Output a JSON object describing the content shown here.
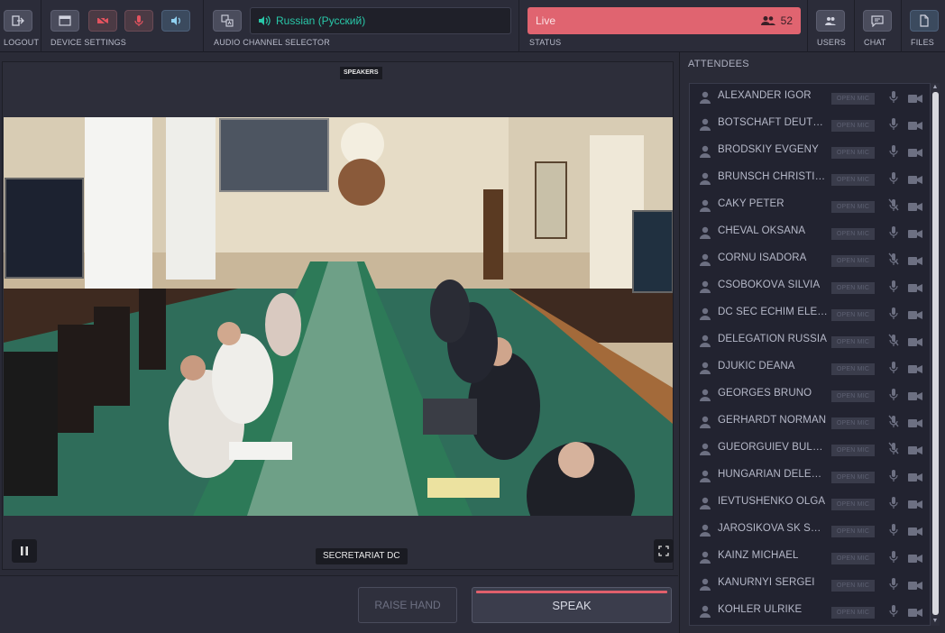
{
  "toolbar": {
    "logout_label": "LOGOUT",
    "device_settings_label": "DEVICE SETTINGS",
    "audio_channel_label": "AUDIO CHANNEL SELECTOR",
    "audio_language": "Russian (Русский)",
    "status_label": "STATUS",
    "status_text": "Live",
    "participant_count": "52",
    "users_label": "USERS",
    "chat_label": "CHAT",
    "files_label": "FILES"
  },
  "video": {
    "speakers_tag": "SPEAKERS",
    "source_label": "SECRETARIAT DC"
  },
  "actions": {
    "raise_hand": "RAISE HAND",
    "speak": "SPEAK"
  },
  "attendees": {
    "title": "ATTENDEES",
    "open_mic_label": "OPEN MIC",
    "items": [
      {
        "name": "ALEXANDER IGOR",
        "mic_muted": false
      },
      {
        "name": "BOTSCHAFT DEUTSCHLAND",
        "mic_muted": false
      },
      {
        "name": "BRODSKIY EVGENY",
        "mic_muted": false
      },
      {
        "name": "BRUNSCH CHRISTIAN",
        "mic_muted": false
      },
      {
        "name": "CAKY PETER",
        "mic_muted": true
      },
      {
        "name": "CHEVAL OKSANA",
        "mic_muted": false
      },
      {
        "name": "CORNU ISADORA",
        "mic_muted": true
      },
      {
        "name": "CSÖBÖKOVÁ SILVIA",
        "mic_muted": false
      },
      {
        "name": "DC SEC ECHIM ELENA",
        "mic_muted": false
      },
      {
        "name": "DELEGATION RUSSIA",
        "mic_muted": true
      },
      {
        "name": "DJUKIC DEANA",
        "mic_muted": false
      },
      {
        "name": "GEORGES BRUNO",
        "mic_muted": false
      },
      {
        "name": "GERHARDT NORMAN",
        "mic_muted": true
      },
      {
        "name": "GUEORGUIEV BULGARIA",
        "mic_muted": true
      },
      {
        "name": "HUNGARIAN DELEGATION",
        "mic_muted": false
      },
      {
        "name": "IEVTUSHENKO OLGA",
        "mic_muted": false
      },
      {
        "name": "JAROSIKOVA SK SOURCE",
        "mic_muted": false
      },
      {
        "name": "KAINZ MICHAEL",
        "mic_muted": false
      },
      {
        "name": "KANURNYI SERGEI",
        "mic_muted": false
      },
      {
        "name": "KÖHLER ULRIKE",
        "mic_muted": false
      }
    ]
  }
}
